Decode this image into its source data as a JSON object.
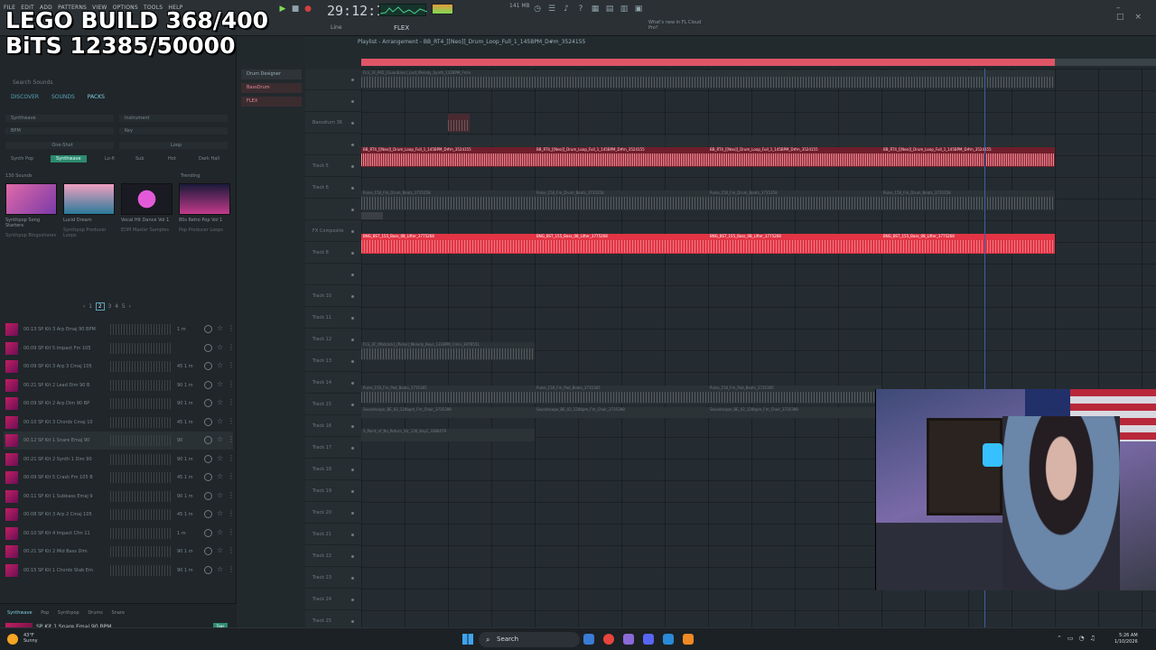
{
  "overlay": {
    "line1": "LEGO BUILD 368/400",
    "line2": "BiTS 12385/50000"
  },
  "menu": [
    "FILE",
    "EDIT",
    "ADD",
    "PATTERNS",
    "VIEW",
    "OPTIONS",
    "TOOLS",
    "HELP"
  ],
  "transport": {
    "time": "29:12:16",
    "bpm": "141 MB",
    "line_mode": "Line",
    "snap": "FLEX",
    "news": "What's new in FL Cloud Pro?"
  },
  "browser": {
    "search_placeholder": "Search Sounds",
    "tabs": [
      "DISCOVER",
      "SOUNDS",
      "PACKS"
    ],
    "filters": {
      "genre": "Synthwave",
      "instrument": "Instrument",
      "bpm": "BPM",
      "key": "Key",
      "oneshot": "One-Shot",
      "loop": "Loop"
    },
    "chips": [
      "Synth Pop",
      "Synthwave",
      "Lo-fi",
      "Sub",
      "Hot",
      "Dark Hall"
    ],
    "count": "130 Sounds",
    "trending": "Trending",
    "packs": [
      {
        "title": "Synthpop Song Starters",
        "sub": "Synthpop Bingoshares"
      },
      {
        "title": "Lucid Dream",
        "sub": "Synthpop Producer Loops"
      },
      {
        "title": "Vocal Hit Dance Vol 1",
        "sub": "EDM Master Samples"
      },
      {
        "title": "80s Retro Pop Vol 1",
        "sub": "Pop Producer Loops"
      }
    ],
    "pages": [
      "1",
      "2",
      "3",
      "4",
      "5"
    ],
    "current_page": "2",
    "samples": [
      {
        "time": "00:13",
        "name": "SP Kit 3 Arp Emaj 90 BPM",
        "bpm": "1 m"
      },
      {
        "time": "00:09",
        "name": "SP Kit 5 Impact Fm 105",
        "bpm": ""
      },
      {
        "time": "00:09",
        "name": "SP Kit 3 Arp 3 Cmaj 105",
        "bpm": "45 1 m"
      },
      {
        "time": "00:21",
        "name": "SP Kit 2 Lead Dim 90 B",
        "bpm": "90 1 m"
      },
      {
        "time": "00:09",
        "name": "SP Kit 2 Arp Dim 90 BP",
        "bpm": "90 1 m"
      },
      {
        "time": "00:10",
        "name": "SP Kit 3 Chords Cmaj 10",
        "bpm": "45 1 m"
      },
      {
        "time": "00:12",
        "name": "SP Kit 1 Snare Emaj 90",
        "bpm": "90"
      },
      {
        "time": "00:21",
        "name": "SP Kit 2 Synth 1 Dim 90",
        "bpm": "90 1 m"
      },
      {
        "time": "00:09",
        "name": "SP Kit 5 Crash Fm 105 B",
        "bpm": "45 1 m"
      },
      {
        "time": "00:11",
        "name": "SP Kit 1 Subbass Emaj 9",
        "bpm": "90 1 m"
      },
      {
        "time": "00:08",
        "name": "SP Kit 3 Arp 2 Cmaj 105",
        "bpm": "45 1 m"
      },
      {
        "time": "00:10",
        "name": "SP Kit 4 Impact Cfm 11",
        "bpm": "1 m"
      },
      {
        "time": "00:21",
        "name": "SP Kit 2 Mid Bass Dim",
        "bpm": "90 1 m"
      },
      {
        "time": "00:15",
        "name": "SP Kit 1 Chords Stab Em",
        "bpm": "90 1 m"
      }
    ],
    "now_playing": {
      "tags": [
        "Synthwave",
        "Pop",
        "Synthpop",
        "Drums",
        "Snare"
      ],
      "title": "SP Kit 1 Snare Emaj 90 BPM",
      "tag": "Tags"
    }
  },
  "channels": [
    "Drum Designer",
    "BassDrum",
    "FLEX"
  ],
  "playlist": {
    "title": "Playlist - Arrangement - BB_RT4_[[Neo]]_Drum_Loop_Full_1_145BPM_D#m_3524155",
    "tracks": [
      "",
      "",
      "Bassdrum 36",
      "",
      "Track 5",
      "Track 6",
      "",
      "FX Composite",
      "Track 8",
      "",
      "Track 10",
      "Track 11",
      "Track 12",
      "Track 13",
      "Track 14",
      "Track 15",
      "Track 16",
      "Track 17",
      "Track 18",
      "Track 19",
      "Track 20",
      "Track 21",
      "Track 22",
      "Track 23",
      "Track 24",
      "Track 25"
    ],
    "clip_top": "FLS_3F_P65_[Guardians]_Lost_Melody_Synth_132BPM_Fmin",
    "clip_red": "BB_RT4_[[Neo]]_Drum_Loop_Full_1_145BPM_D#m_3524155",
    "clip_gray": "Pulse_150_Fm_Drum_Beats_3735358",
    "clip_bass": "BNG_BST_155_Bass_08_Lifter_3775268",
    "clip_track15": "FLS_3F_[Midclick]_[Pulse]_Melody_Keys_131BPM_Cmin_3476551",
    "clip_track17a": "Pulse_150_Fm_Pad_Beats_3735365",
    "clip_track17b": "Soundscape_BE_03_120bpm_Fm_Choir_3735398",
    "clip_track18": "S_Point_of_No_Return_Str_126_Key1_3386479"
  },
  "taskbar": {
    "temp": "43°F",
    "weather": "Sunny",
    "search": "Search",
    "time": "5:26 AM",
    "date": "1/10/2026"
  },
  "colors": {
    "accent_red": "#e23444",
    "accent_teal": "#2e8a6e",
    "playlist_bg": "#242c31"
  }
}
